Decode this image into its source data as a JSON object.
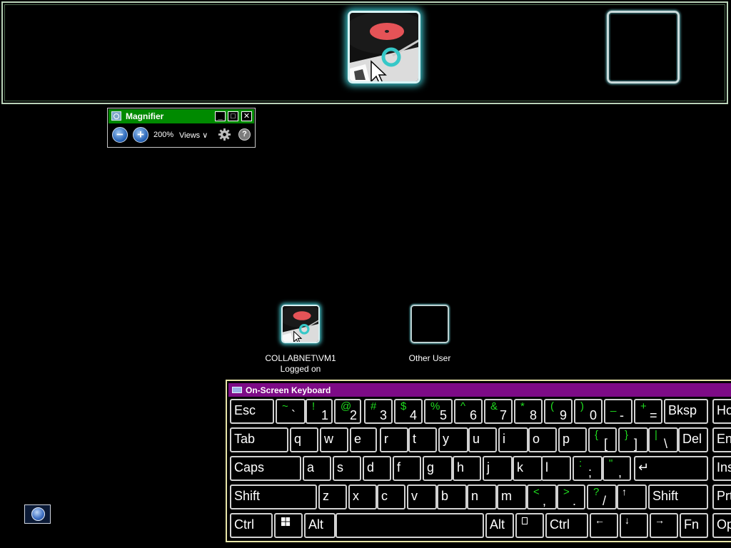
{
  "magnifier": {
    "title": "Magnifier",
    "zoom": "200%",
    "views_label": "Views",
    "views_arrow": "∨",
    "minimize_glyph": "_",
    "maximize_glyph": "□",
    "close_glyph": "✕",
    "zoom_out_glyph": "−",
    "zoom_in_glyph": "+",
    "help_glyph": "?",
    "icons": [
      "magnifier-app-icon",
      "zoom-out-icon",
      "zoom-in-icon",
      "gear-icon",
      "help-icon"
    ]
  },
  "logon": {
    "users": [
      {
        "name": "COLLABNET\\VM1",
        "status": "Logged on"
      },
      {
        "name": "Other User"
      }
    ]
  },
  "ease_of_access": {
    "icon": "ease-of-access-icon"
  },
  "osk": {
    "title": "On-Screen Keyboard",
    "symbol_color": "#1fdc1f",
    "title_color": "#7d0b86",
    "rows": [
      [
        {
          "id": "esc",
          "label": "Esc"
        },
        {
          "id": "backtick",
          "top": "~",
          "bottom": "`"
        },
        {
          "id": "1",
          "top": "!",
          "bottom": "1"
        },
        {
          "id": "2",
          "top": "@",
          "bottom": "2"
        },
        {
          "id": "3",
          "top": "#",
          "bottom": "3"
        },
        {
          "id": "4",
          "top": "$",
          "bottom": "4"
        },
        {
          "id": "5",
          "top": "%",
          "bottom": "5"
        },
        {
          "id": "6",
          "top": "^",
          "bottom": "6"
        },
        {
          "id": "7",
          "top": "&",
          "bottom": "7"
        },
        {
          "id": "8",
          "top": "*",
          "bottom": "8"
        },
        {
          "id": "9",
          "top": "(",
          "bottom": "9"
        },
        {
          "id": "0",
          "top": ")",
          "bottom": "0"
        },
        {
          "id": "minus",
          "top": "_",
          "bottom": "-"
        },
        {
          "id": "equals",
          "top": "+",
          "bottom": "="
        },
        {
          "id": "bksp",
          "label": "Bksp"
        },
        {
          "id": "home",
          "label": "Home"
        }
      ],
      [
        {
          "id": "tab",
          "label": "Tab"
        },
        {
          "id": "q",
          "label": "q"
        },
        {
          "id": "w",
          "label": "w"
        },
        {
          "id": "e",
          "label": "e"
        },
        {
          "id": "r",
          "label": "r"
        },
        {
          "id": "t",
          "label": "t"
        },
        {
          "id": "y",
          "label": "y"
        },
        {
          "id": "u",
          "label": "u"
        },
        {
          "id": "i",
          "label": "i"
        },
        {
          "id": "o",
          "label": "o"
        },
        {
          "id": "p",
          "label": "p"
        },
        {
          "id": "lbracket",
          "top": "{",
          "bottom": "["
        },
        {
          "id": "rbracket",
          "top": "}",
          "bottom": "]"
        },
        {
          "id": "backslash",
          "top": "|",
          "bottom": "\\"
        },
        {
          "id": "del",
          "label": "Del"
        },
        {
          "id": "end",
          "label": "End"
        }
      ],
      [
        {
          "id": "caps",
          "label": "Caps"
        },
        {
          "id": "a",
          "label": "a"
        },
        {
          "id": "s",
          "label": "s"
        },
        {
          "id": "d",
          "label": "d"
        },
        {
          "id": "f",
          "label": "f"
        },
        {
          "id": "g",
          "label": "g"
        },
        {
          "id": "h",
          "label": "h"
        },
        {
          "id": "j",
          "label": "j"
        },
        {
          "id": "k",
          "label": "k"
        },
        {
          "id": "l",
          "label": "l"
        },
        {
          "id": "semicolon",
          "top": ":",
          "bottom": ";"
        },
        {
          "id": "quote",
          "top": "\"",
          "bottom": ","
        },
        {
          "id": "enter",
          "label": "↵"
        },
        {
          "id": "insert",
          "label": "Insert"
        }
      ],
      [
        {
          "id": "lshift",
          "label": "Shift"
        },
        {
          "id": "z",
          "label": "z"
        },
        {
          "id": "x",
          "label": "x"
        },
        {
          "id": "c",
          "label": "c"
        },
        {
          "id": "v",
          "label": "v"
        },
        {
          "id": "b",
          "label": "b"
        },
        {
          "id": "n",
          "label": "n"
        },
        {
          "id": "m",
          "label": "m"
        },
        {
          "id": "comma",
          "top": "<",
          "bottom": ","
        },
        {
          "id": "period",
          "top": ">",
          "bottom": "."
        },
        {
          "id": "slash",
          "top": "?",
          "bottom": "/"
        },
        {
          "id": "up",
          "label": "↑"
        },
        {
          "id": "rshift",
          "label": "Shift"
        },
        {
          "id": "prtscn",
          "label": "PrtScn"
        }
      ],
      [
        {
          "id": "lctrl",
          "label": "Ctrl"
        },
        {
          "id": "lwin",
          "label": "",
          "icon": "windows-logo-icon"
        },
        {
          "id": "lalt",
          "label": "Alt"
        },
        {
          "id": "space",
          "label": ""
        },
        {
          "id": "ralt",
          "label": "Alt"
        },
        {
          "id": "menu",
          "label": "",
          "icon": "context-menu-icon"
        },
        {
          "id": "rctrl",
          "label": "Ctrl"
        },
        {
          "id": "left",
          "label": "←"
        },
        {
          "id": "down",
          "label": "↓"
        },
        {
          "id": "right",
          "label": "→"
        },
        {
          "id": "fn",
          "label": "Fn"
        },
        {
          "id": "options",
          "label": "Options"
        }
      ]
    ]
  }
}
